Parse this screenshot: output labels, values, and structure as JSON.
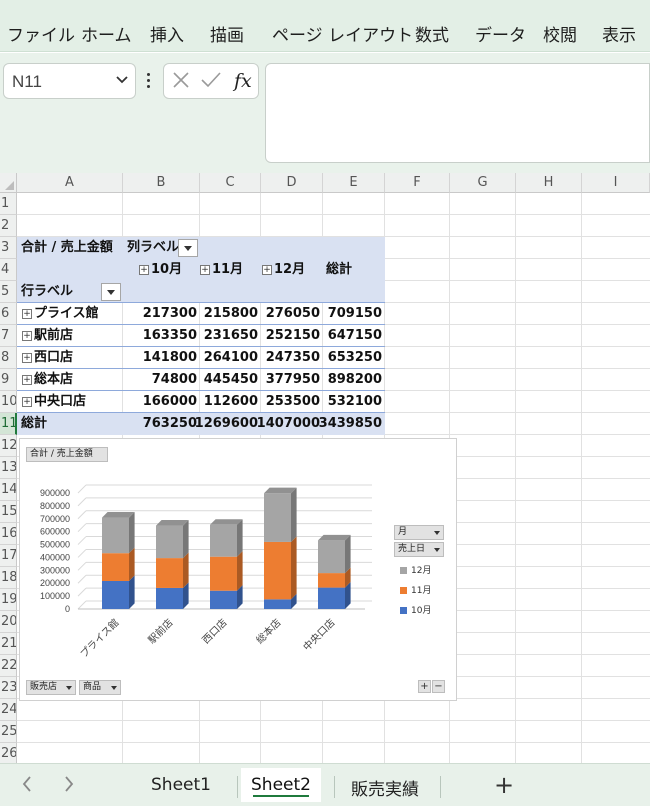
{
  "ribbon": {
    "tabs": [
      "ファイル",
      "ホーム",
      "挿入",
      "描画",
      "ページ レイアウト",
      "数式",
      "データ",
      "校閲",
      "表示"
    ]
  },
  "formula_bar": {
    "name_box": "N11",
    "fx_label": "fx",
    "cancel_icon": "close-icon",
    "enter_icon": "check-icon",
    "formula": ""
  },
  "grid": {
    "columns": [
      "A",
      "B",
      "C",
      "D",
      "E",
      "F",
      "G",
      "H",
      "I"
    ],
    "rows": [
      "1",
      "2",
      "3",
      "4",
      "5",
      "6",
      "7",
      "8",
      "9",
      "10",
      "11",
      "12",
      "13",
      "14",
      "15",
      "16",
      "17",
      "18",
      "19",
      "20",
      "21",
      "22",
      "23",
      "24",
      "25",
      "26"
    ],
    "selected_row": "11"
  },
  "pivot": {
    "value_field": "合計 / 売上金額",
    "column_label": "列ラベル",
    "row_label": "行ラベル",
    "column_headers": [
      "10月",
      "11月",
      "12月",
      "総計"
    ],
    "rows": [
      {
        "label": "プライス館",
        "values": [
          "217300",
          "215800",
          "276050",
          "709150"
        ]
      },
      {
        "label": "駅前店",
        "values": [
          "163350",
          "231650",
          "252150",
          "647150"
        ]
      },
      {
        "label": "西口店",
        "values": [
          "141800",
          "264100",
          "247350",
          "653250"
        ]
      },
      {
        "label": "総本店",
        "values": [
          "74800",
          "445450",
          "377950",
          "898200"
        ]
      },
      {
        "label": "中央口店",
        "values": [
          "166000",
          "112600",
          "253500",
          "532100"
        ]
      }
    ],
    "total": {
      "label": "総計",
      "values": [
        "763250",
        "1269600",
        "1407000",
        "3439850"
      ]
    }
  },
  "chart": {
    "value_button": "合計 / 売上金額",
    "legend_filters": [
      "月",
      "売上日"
    ],
    "axis_filters": [
      "販売店",
      "商品"
    ],
    "zoom": [
      "+",
      "−"
    ],
    "colors": {
      "10月": "#4472c4",
      "11月": "#ed7d31",
      "12月": "#a5a5a5"
    }
  },
  "chart_data": {
    "type": "bar",
    "stacked": true,
    "three_d": true,
    "categories": [
      "プライス館",
      "駅前店",
      "西口店",
      "総本店",
      "中央口店"
    ],
    "series": [
      {
        "name": "10月",
        "values": [
          217300,
          163350,
          141800,
          74800,
          166000
        ]
      },
      {
        "name": "11月",
        "values": [
          215800,
          231650,
          264100,
          445450,
          112600
        ]
      },
      {
        "name": "12月",
        "values": [
          276050,
          252150,
          247350,
          377950,
          253500
        ]
      }
    ],
    "legend_order": [
      "12月",
      "11月",
      "10月"
    ],
    "yticks": [
      "900000",
      "800000",
      "700000",
      "600000",
      "500000",
      "400000",
      "300000",
      "200000",
      "100000",
      "0"
    ],
    "ylim": [
      0,
      900000
    ],
    "grid": true,
    "legend": "right"
  },
  "sheets": {
    "tabs": [
      "Sheet1",
      "Sheet2",
      "販売実績"
    ],
    "active": "Sheet2",
    "add_label": "+",
    "prev_icon": "chevron-left-icon",
    "next_icon": "chevron-right-icon"
  }
}
